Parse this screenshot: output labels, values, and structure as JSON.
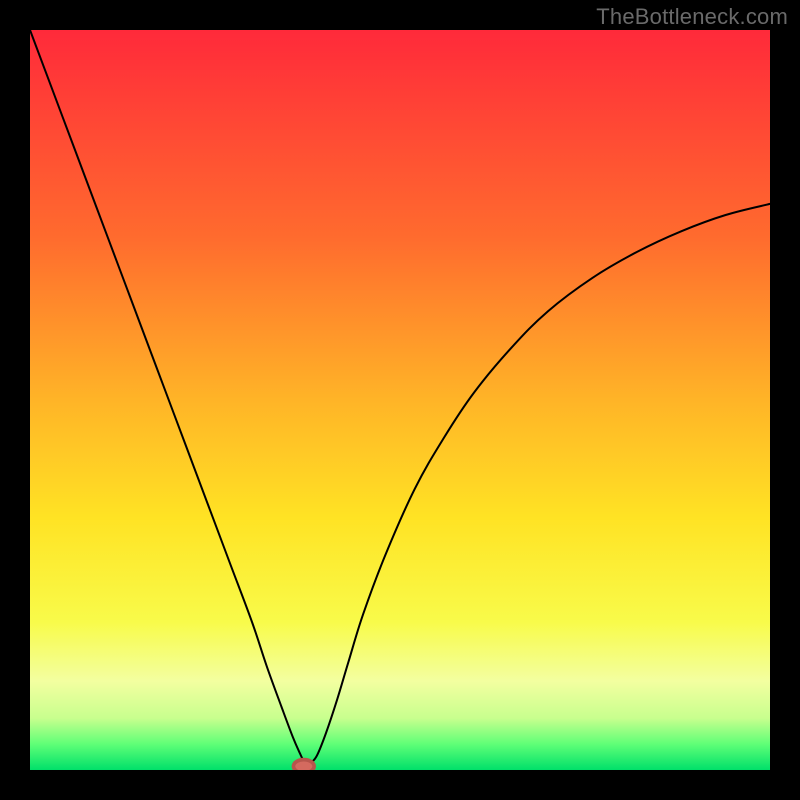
{
  "watermark": "TheBottleneck.com",
  "chart_data": {
    "type": "line",
    "title": "",
    "xlabel": "",
    "ylabel": "",
    "xlim": [
      0,
      100
    ],
    "ylim": [
      0,
      100
    ],
    "grid": false,
    "legend": false,
    "background_gradient": {
      "stops": [
        {
          "offset": 0.0,
          "color": "#ff2a3a"
        },
        {
          "offset": 0.28,
          "color": "#ff6b2e"
        },
        {
          "offset": 0.5,
          "color": "#ffb427"
        },
        {
          "offset": 0.66,
          "color": "#ffe324"
        },
        {
          "offset": 0.8,
          "color": "#f8fb4a"
        },
        {
          "offset": 0.88,
          "color": "#f3ffa0"
        },
        {
          "offset": 0.93,
          "color": "#c8ff8e"
        },
        {
          "offset": 0.965,
          "color": "#5fff77"
        },
        {
          "offset": 1.0,
          "color": "#00e06a"
        }
      ]
    },
    "series": [
      {
        "name": "bottleneck-curve",
        "color": "#000000",
        "x": [
          0,
          3,
          6,
          9,
          12,
          15,
          18,
          21,
          24,
          27,
          30,
          32,
          34,
          35.5,
          36.5,
          37,
          37.5,
          38,
          38.8,
          40,
          41.5,
          43,
          45,
          48,
          52,
          56,
          60,
          65,
          70,
          76,
          82,
          88,
          94,
          100
        ],
        "y": [
          100,
          92,
          84,
          76,
          68,
          60,
          52,
          44,
          36,
          28,
          20,
          14,
          8.5,
          4.5,
          2.2,
          1.2,
          0.7,
          1.0,
          2.0,
          5.0,
          9.5,
          14.5,
          21,
          29,
          38,
          45,
          51,
          57,
          62,
          66.5,
          70,
          72.8,
          75,
          76.5
        ]
      }
    ],
    "markers": [
      {
        "name": "optimal-point",
        "x": 37,
        "y": 0.5,
        "color": "#d46a5f"
      }
    ]
  }
}
